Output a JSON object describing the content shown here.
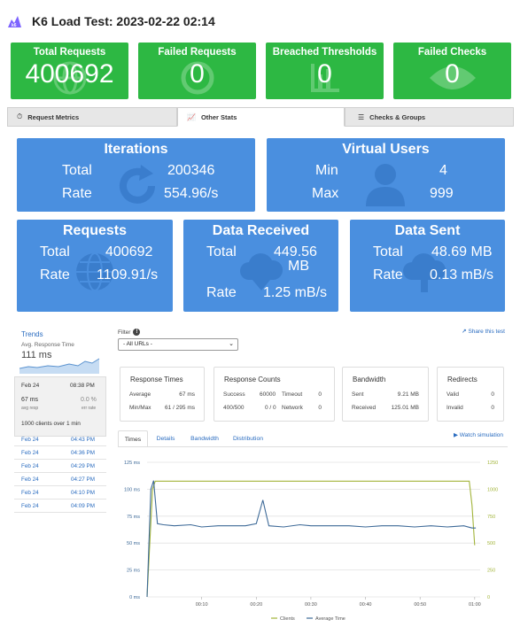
{
  "header": {
    "logo_text": "k6",
    "title": "K6 Load Test: 2023-02-22 02:14"
  },
  "top_cards": [
    {
      "label": "Total Requests",
      "value": "400692",
      "icon": "globe-icon"
    },
    {
      "label": "Failed Requests",
      "value": "0",
      "icon": "ban-icon"
    },
    {
      "label": "Breached Thresholds",
      "value": "0",
      "icon": "chart-icon"
    },
    {
      "label": "Failed Checks",
      "value": "0",
      "icon": "eye-icon"
    }
  ],
  "colors": {
    "green": "#2db843",
    "blue": "#4a8fdf",
    "link": "#2a6cc0",
    "clients": "#a2b43a",
    "avg_time": "#3e6a98"
  },
  "tabs": [
    {
      "label": "Request Metrics",
      "icon": "clock-icon"
    },
    {
      "label": "Other Stats",
      "icon": "chart-line-icon",
      "active": true
    },
    {
      "label": "Checks & Groups",
      "icon": "list-icon"
    }
  ],
  "iterations": {
    "title": "Iterations",
    "total_label": "Total",
    "total": "200346",
    "rate_label": "Rate",
    "rate": "554.96/s"
  },
  "virtual_users": {
    "title": "Virtual Users",
    "min_label": "Min",
    "min": "4",
    "max_label": "Max",
    "max": "999"
  },
  "requests": {
    "title": "Requests",
    "total_label": "Total",
    "total": "400692",
    "rate_label": "Rate",
    "rate": "1109.91/s"
  },
  "data_received": {
    "title": "Data Received",
    "total_label": "Total",
    "total_line1": "449.56",
    "total_line2": "MB",
    "rate_label": "Rate",
    "rate": "1.25 mB/s"
  },
  "data_sent": {
    "title": "Data Sent",
    "total_label": "Total",
    "total": "48.69 MB",
    "rate_label": "Rate",
    "rate": "0.13 mB/s"
  },
  "trends": {
    "title": "Trends",
    "metric": "Avg. Response Time",
    "value": "111 ms",
    "selected": {
      "date": "Feb 24",
      "time": "08:38 PM",
      "resp": "67 ms",
      "resp_label": "avg resp",
      "err": "0.0 %",
      "err_label": "err rate",
      "clients": "1000 clients over 1 min"
    },
    "history": [
      {
        "date": "Feb 24",
        "time": "04:43 PM"
      },
      {
        "date": "Feb 24",
        "time": "04:36 PM"
      },
      {
        "date": "Feb 24",
        "time": "04:29 PM"
      },
      {
        "date": "Feb 24",
        "time": "04:27 PM"
      },
      {
        "date": "Feb 24",
        "time": "04:10 PM"
      },
      {
        "date": "Feb 24",
        "time": "04:09 PM"
      }
    ]
  },
  "filter": {
    "label": "Filter",
    "value": "- All URLs -"
  },
  "share": "Share this test",
  "response_times": {
    "title": "Response Times",
    "average_label": "Average",
    "average": "67 ms",
    "minmax_label": "Min/Max",
    "minmax": "61 / 295 ms"
  },
  "response_counts": {
    "title": "Response Counts",
    "success_label": "Success",
    "success": "60000",
    "timeout_label": "Timeout",
    "timeout": "0",
    "r400_label": "400/500",
    "r400": "0 / 0",
    "network_label": "Network",
    "network": "0"
  },
  "bandwidth": {
    "title": "Bandwidth",
    "sent_label": "Sent",
    "sent": "9.21 MB",
    "received_label": "Received",
    "received": "125.01 MB"
  },
  "redirects": {
    "title": "Redirects",
    "valid_label": "Valid",
    "valid": "0",
    "invalid_label": "Invalid",
    "invalid": "0"
  },
  "subtabs": [
    "Times",
    "Details",
    "Bandwidth",
    "Distribution"
  ],
  "watch": "Watch simulation",
  "chart_data": {
    "type": "line",
    "x_ticks": [
      "00:10",
      "00:20",
      "00:30",
      "00:40",
      "00:50",
      "01:00"
    ],
    "left_ticks": [
      "0 ms",
      "25 ms",
      "50 ms",
      "75 ms",
      "100 ms",
      "125 ms"
    ],
    "right_ticks": [
      "0",
      "250",
      "500",
      "750",
      "1000",
      "1250"
    ],
    "left_ylim": [
      0,
      125
    ],
    "right_ylim": [
      0,
      1250
    ],
    "x_range": [
      0,
      61
    ],
    "series": [
      {
        "name": "Clients",
        "axis": "right",
        "points": [
          [
            0,
            0
          ],
          [
            1,
            1000
          ],
          [
            1.5,
            1075
          ],
          [
            10,
            1075
          ],
          [
            20,
            1075
          ],
          [
            30,
            1075
          ],
          [
            40,
            1075
          ],
          [
            50,
            1075
          ],
          [
            58,
            1075
          ],
          [
            59,
            1075
          ],
          [
            59.5,
            850
          ],
          [
            60,
            480
          ]
        ]
      },
      {
        "name": "Average Time",
        "axis": "left",
        "points": [
          [
            0,
            0
          ],
          [
            0.7,
            100
          ],
          [
            1.2,
            108
          ],
          [
            1.9,
            68
          ],
          [
            3,
            67
          ],
          [
            5,
            66
          ],
          [
            8,
            67
          ],
          [
            10,
            65
          ],
          [
            13,
            66
          ],
          [
            16,
            66
          ],
          [
            18,
            66
          ],
          [
            20,
            68
          ],
          [
            21.2,
            90
          ],
          [
            22.3,
            66
          ],
          [
            25,
            65
          ],
          [
            28,
            67
          ],
          [
            30,
            66
          ],
          [
            34,
            66
          ],
          [
            37,
            66
          ],
          [
            40,
            65
          ],
          [
            43,
            66
          ],
          [
            46,
            66
          ],
          [
            49,
            65
          ],
          [
            52,
            66
          ],
          [
            55,
            65
          ],
          [
            58,
            66
          ],
          [
            59.5,
            64
          ],
          [
            60.2,
            64
          ]
        ]
      }
    ]
  }
}
